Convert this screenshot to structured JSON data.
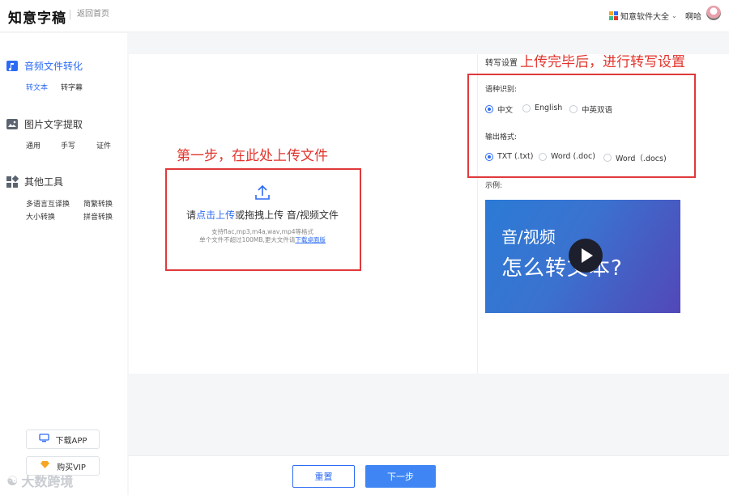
{
  "header": {
    "logo": "知意字稿",
    "back_home": "返回首页",
    "suite_link": "知意软件大全",
    "username": "啊哈"
  },
  "sidebar": {
    "groups": [
      {
        "title": "音频文件转化",
        "icon": "audio-file-icon",
        "items": [
          "转文本",
          "转字幕"
        ]
      },
      {
        "title": "图片文字提取",
        "icon": "image-icon",
        "items": [
          "通用",
          "手写",
          "证件"
        ]
      },
      {
        "title": "其他工具",
        "icon": "tools-grid-icon",
        "items": [
          "多语言互译换",
          "简繁转换",
          "大小转换",
          "拼音转换"
        ]
      }
    ],
    "download_app": "下载APP",
    "buy_vip": "购买VIP"
  },
  "upload": {
    "main_prefix": "请",
    "main_link": "点击上传",
    "main_suffix": "或拖拽上传 音/视频文件",
    "hint_line1": "支持flac,mp3,m4a,wav,mp4等格式",
    "hint_line2_prefix": "单个文件不超过100MB,更大文件请",
    "hint_line2_link": "下载桌面版"
  },
  "annotations": {
    "step1": "第一步，在此处上传文件",
    "settings_note": "上传完毕后，进行转写设置"
  },
  "settings": {
    "title": "转写设置",
    "language_label": "语种识别:",
    "languages": [
      "中文",
      "English",
      "中英双语"
    ],
    "language_selected": "中文",
    "format_label": "输出格式:",
    "formats": [
      "TXT (.txt)",
      "Word (.doc)",
      "Word（.docs)"
    ],
    "format_selected": "TXT (.txt)",
    "example_label": "示例:",
    "video_line1": "音/视频",
    "video_line2": "怎么转文本?"
  },
  "footer": {
    "reset": "重置",
    "next": "下一步"
  },
  "watermark": "大数跨境",
  "colors": {
    "accent": "#2d6bf4",
    "annotation_red": "#e2342c",
    "next_button": "#3f86f4"
  }
}
